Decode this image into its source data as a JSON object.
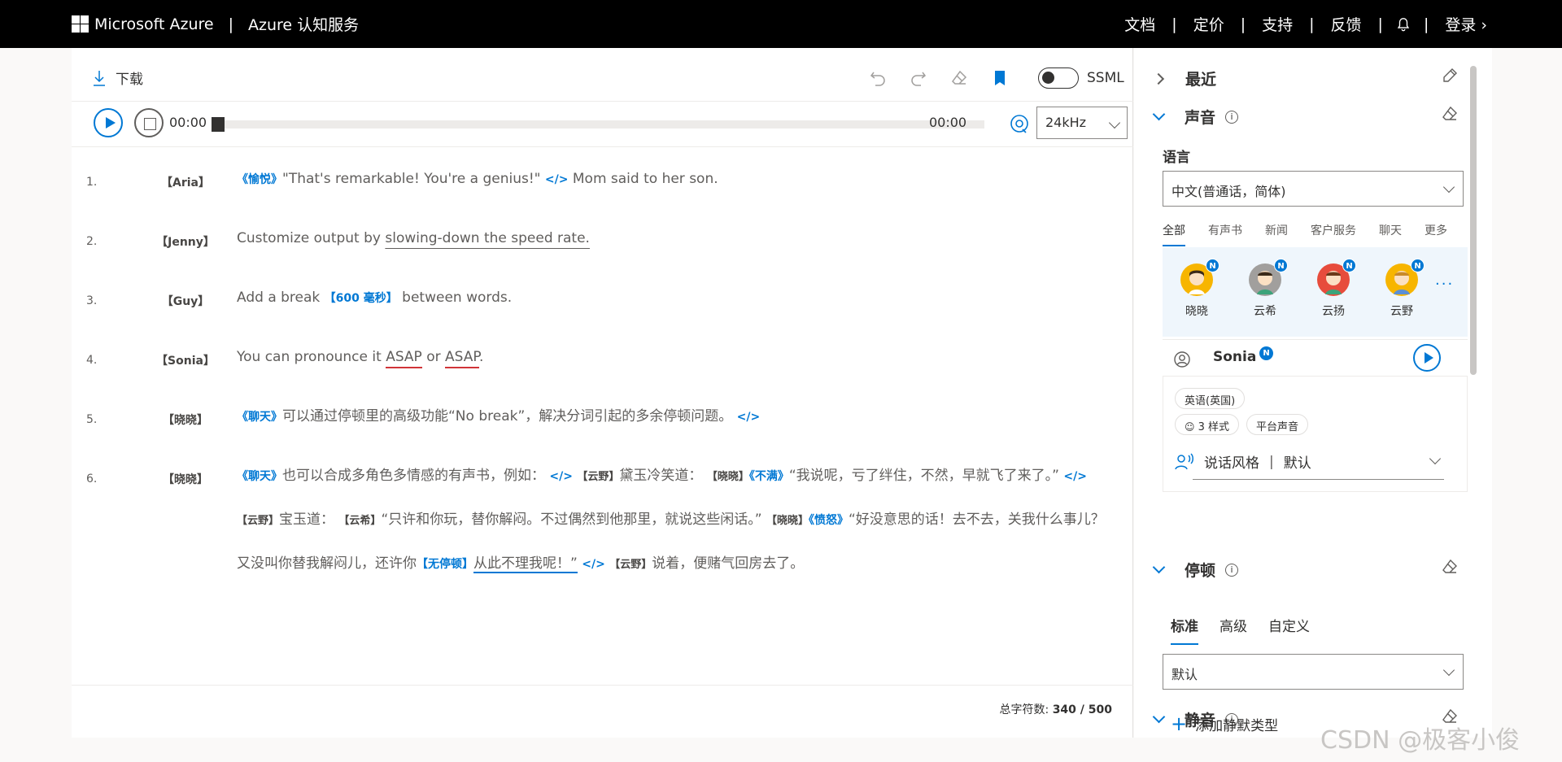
{
  "header": {
    "brand": "Microsoft Azure",
    "separator": "|",
    "product": "Azure 认知服务",
    "nav": [
      "文档",
      "定价",
      "支持",
      "反馈"
    ],
    "login": "登录 ›"
  },
  "toolbar": {
    "download": "下载",
    "ssml": "SSML",
    "icons": [
      "undo-icon",
      "redo-icon",
      "eraser-icon",
      "bookmark-icon"
    ],
    "bookmark_color": "#0078d4"
  },
  "player": {
    "time_start": "00:00",
    "time_end": "00:00",
    "rate": "24kHz",
    "progress": 0
  },
  "lines": [
    {
      "num": "1.",
      "speaker": "【Aria】"
    },
    {
      "num": "2.",
      "speaker": "【Jenny】"
    },
    {
      "num": "3.",
      "speaker": "【Guy】"
    },
    {
      "num": "4.",
      "speaker": "【Sonia】"
    },
    {
      "num": "5.",
      "speaker": "【晓晓】"
    },
    {
      "num": "6.",
      "speaker": "【晓晓】"
    }
  ],
  "text": {
    "l1_tag": "《愉悦》",
    "l1_text": "\"That's remarkable! You're a genius!\"",
    "l1_end": "</>",
    "l1_tail": "Mom said to her son.",
    "l2_a": "Customize output by ",
    "l2_b": "slowing-down the speed rate.",
    "l3_a": "Add a break ",
    "l3_tag": "【600 毫秒】",
    "l3_b": " between words.",
    "l4_a": "You can pronounce it ",
    "l4_w1": "ASAP",
    "l4_mid": " or ",
    "l4_w2": "ASAP",
    "l4_end": ".",
    "l5_tag": "《聊天》",
    "l5_text": "可以通过停顿里的高级功能“No break”，解决分词引起的多余停顿问题。",
    "l5_end": "</>",
    "l6_tag1": "《聊天》",
    "l6_t1": "也可以合成多角色多情感的有声书，例如：",
    "l6_end": "</>",
    "l6_s_yunye": "【云野】",
    "l6_t2": "黛玉冷笑道：",
    "l6_s_xiaoxiao": "【晓晓】",
    "l6_tag2": "《不满》",
    "l6_t3": "“我说呢，亏了绊住，不然，早就飞了来了。”",
    "l6_t4": "宝玉道：",
    "l6_s_yunxi": "【云希】",
    "l6_t5": "“只许和你玩，替你解闷。不过偶然到他那里，就说这些闲话。”",
    "l6_tag3": "《愤怒》",
    "l6_t6": "“好没意思的话！去不去，关我什么事儿？又没叫你替我解闷儿，还许你",
    "l6_tag4": "【无停顿】",
    "l6_t7": "从此不理我呢！”",
    "l6_t8": "说着，便赌气回房去了。"
  },
  "char_count": {
    "label": "总字符数: ",
    "value": "340 / 500"
  },
  "panel": {
    "recent": "最近",
    "voice": "声音",
    "language_label": "语言",
    "language": "中文(普通话，简体)",
    "voice_tabs": [
      "全部",
      "有声书",
      "新闻",
      "客户服务",
      "聊天",
      "更多"
    ],
    "voices": [
      {
        "name": "晓晓",
        "color": "#f7b500"
      },
      {
        "name": "云希",
        "color": "#a19f9d"
      },
      {
        "name": "云扬",
        "color": "#e74c3c"
      },
      {
        "name": "云野",
        "color": "#f7b500"
      }
    ],
    "new_badge": "N",
    "more": "...",
    "selected_voice": "Sonia",
    "selected_badge": "N",
    "pill_locale": "英语(英国)",
    "pill_styles": "3 样式",
    "pill_platform": "平台声音",
    "style_label": "说话风格",
    "style_sep": "|",
    "style_value": "默认",
    "pause": "停顿",
    "pause_tabs": [
      "标准",
      "高级",
      "自定义"
    ],
    "pause_value": "默认",
    "silence": "静音",
    "add_silence": "添加静默类型",
    "add_plus": "+"
  },
  "watermark": "CSDN @极客小俊"
}
